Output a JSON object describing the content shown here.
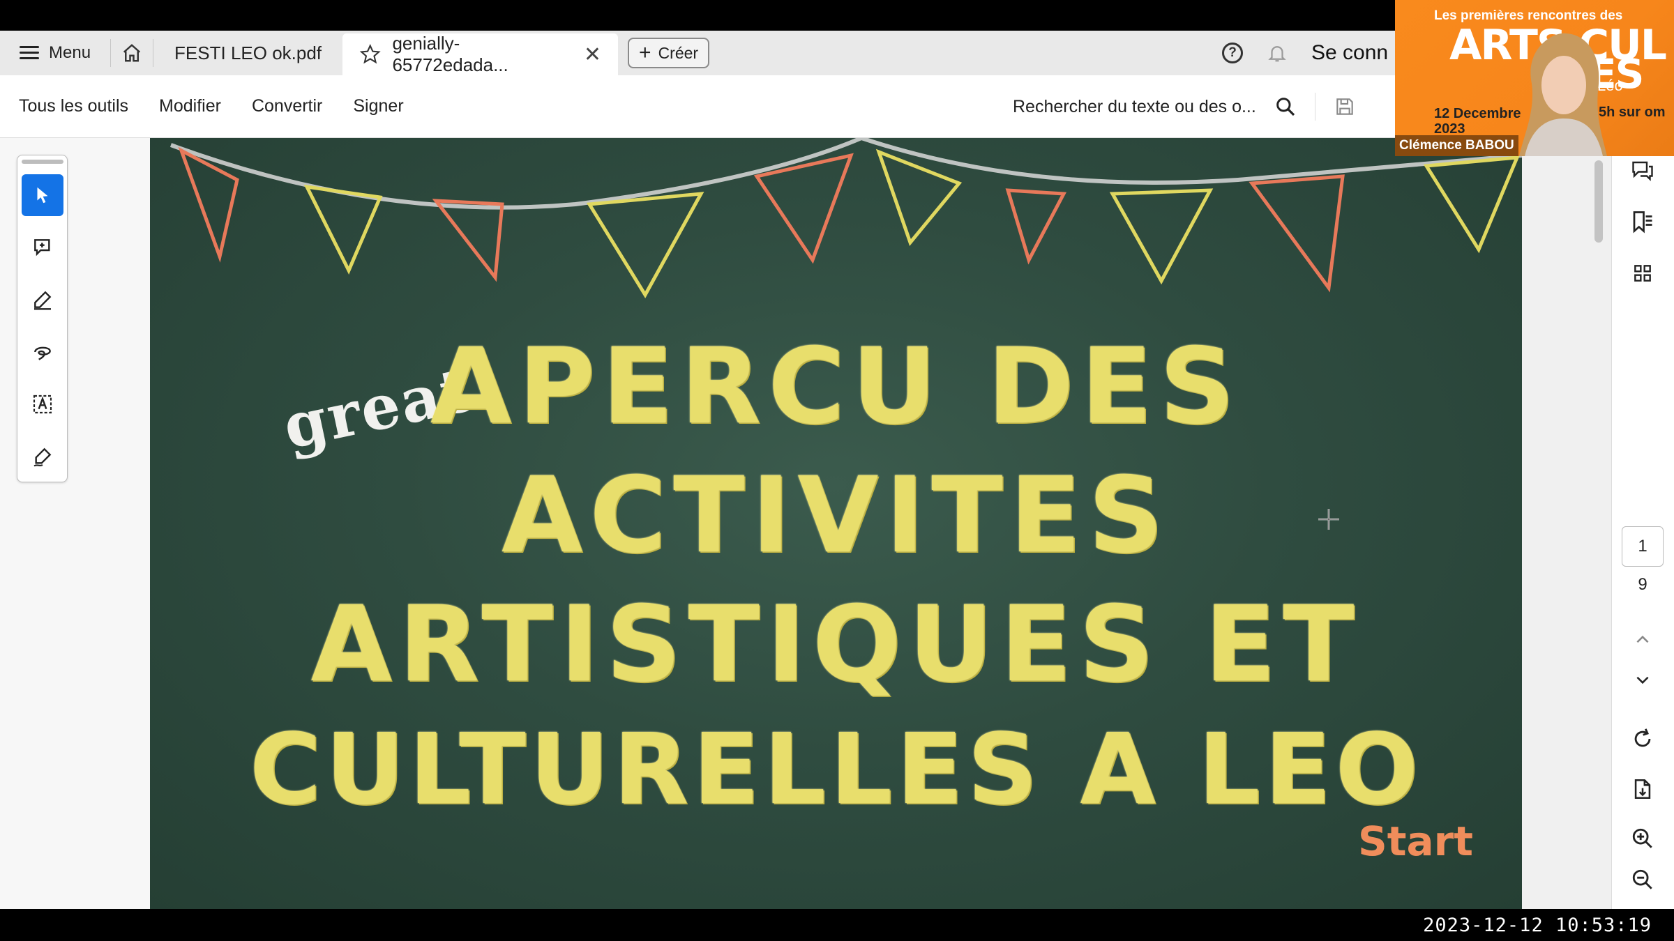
{
  "tabbar": {
    "menu_label": "Menu",
    "tabs": [
      {
        "label": "FESTI LEO ok.pdf"
      },
      {
        "label": "genially-65772edada..."
      }
    ],
    "create_label": "Créer",
    "signin_label": "Se conn"
  },
  "toolbar": {
    "items": [
      "Tous les outils",
      "Modifier",
      "Convertir",
      "Signer"
    ],
    "search_placeholder": "Rechercher du texte ou des o..."
  },
  "slide": {
    "great": "great",
    "lines": [
      "APERCU DES",
      "ACTIVITES",
      "ARTISTIQUES ET",
      "CULTURELLES A LEO"
    ],
    "start": "Start"
  },
  "pagination": {
    "current": "1",
    "total": "9"
  },
  "webcam": {
    "headline": "Les premières rencontres des",
    "big_left": "ARTS CUL",
    "big_right": "ES",
    "leo": "Léo",
    "date": "12 Decembre 2023",
    "date_right": "5h sur om",
    "name": "Clémence BABOU"
  },
  "timestamp": "2023-12-12  10:53:19",
  "colors": {
    "accent": "#1473e6",
    "chalk": "#e8de6c",
    "start": "#f08d5b",
    "board": "#2d4a3e",
    "webcam_bg": "#f98a1d"
  }
}
